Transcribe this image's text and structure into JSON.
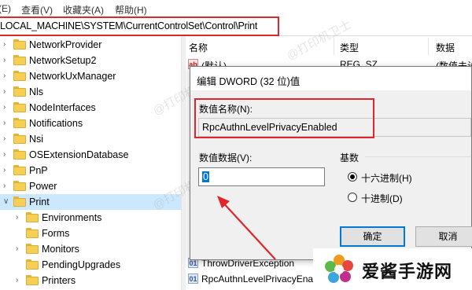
{
  "menu": {
    "items": [
      "(E)",
      "查看(V)",
      "收藏夹(A)",
      "帮助(H)"
    ]
  },
  "address": {
    "path": "LOCAL_MACHINE\\SYSTEM\\CurrentControlSet\\Control\\Print"
  },
  "tree": {
    "items": [
      {
        "label": "NetworkProvider",
        "expandable": true,
        "selected": false,
        "level": 1
      },
      {
        "label": "NetworkSetup2",
        "expandable": true,
        "selected": false,
        "level": 1
      },
      {
        "label": "NetworkUxManager",
        "expandable": true,
        "selected": false,
        "level": 1
      },
      {
        "label": "Nls",
        "expandable": true,
        "selected": false,
        "level": 1
      },
      {
        "label": "NodeInterfaces",
        "expandable": true,
        "selected": false,
        "level": 1
      },
      {
        "label": "Notifications",
        "expandable": true,
        "selected": false,
        "level": 1
      },
      {
        "label": "Nsi",
        "expandable": true,
        "selected": false,
        "level": 1
      },
      {
        "label": "OSExtensionDatabase",
        "expandable": true,
        "selected": false,
        "level": 1
      },
      {
        "label": "PnP",
        "expandable": true,
        "selected": false,
        "level": 1
      },
      {
        "label": "Power",
        "expandable": true,
        "selected": false,
        "level": 1
      },
      {
        "label": "Print",
        "expandable": true,
        "selected": true,
        "level": 1
      },
      {
        "label": "Environments",
        "expandable": true,
        "selected": false,
        "level": 2
      },
      {
        "label": "Forms",
        "expandable": false,
        "selected": false,
        "level": 2
      },
      {
        "label": "Monitors",
        "expandable": true,
        "selected": false,
        "level": 2
      },
      {
        "label": "PendingUpgrades",
        "expandable": false,
        "selected": false,
        "level": 2
      },
      {
        "label": "Printers",
        "expandable": true,
        "selected": false,
        "level": 2
      }
    ]
  },
  "values_pane": {
    "col_name": "名称",
    "col_type": "类型",
    "col_data": "数据",
    "rows": [
      {
        "icon": "ab",
        "name": "(默认)",
        "type": "REG_SZ",
        "data": "(数值未设"
      },
      {
        "icon": "bin",
        "name": "ThrowDriverException",
        "type": "",
        "data": ""
      },
      {
        "icon": "bin",
        "name": "RpcAuthnLevelPrivacyEnabl",
        "type": "",
        "data": ""
      }
    ]
  },
  "dialog": {
    "title": "编辑 DWORD (32 位)值",
    "value_name_label": "数值名称(N):",
    "value_name": "RpcAuthnLevelPrivacyEnabled",
    "value_data_label": "数值数据(V):",
    "value_data": "0",
    "base_label": "基数",
    "radio_hex": "十六进制(H)",
    "radio_dec": "十进制(D)",
    "selected_base": "hex",
    "ok_label": "确定",
    "cancel_label": "取消"
  },
  "watermark": {
    "text": "@打印机卫士"
  },
  "logo": {
    "text": "爱酱手游网"
  },
  "colors": {
    "highlight_red": "#e0262b",
    "selection_blue": "#cce8ff",
    "accent": "#0078d7",
    "folder": "#f7cf55"
  }
}
